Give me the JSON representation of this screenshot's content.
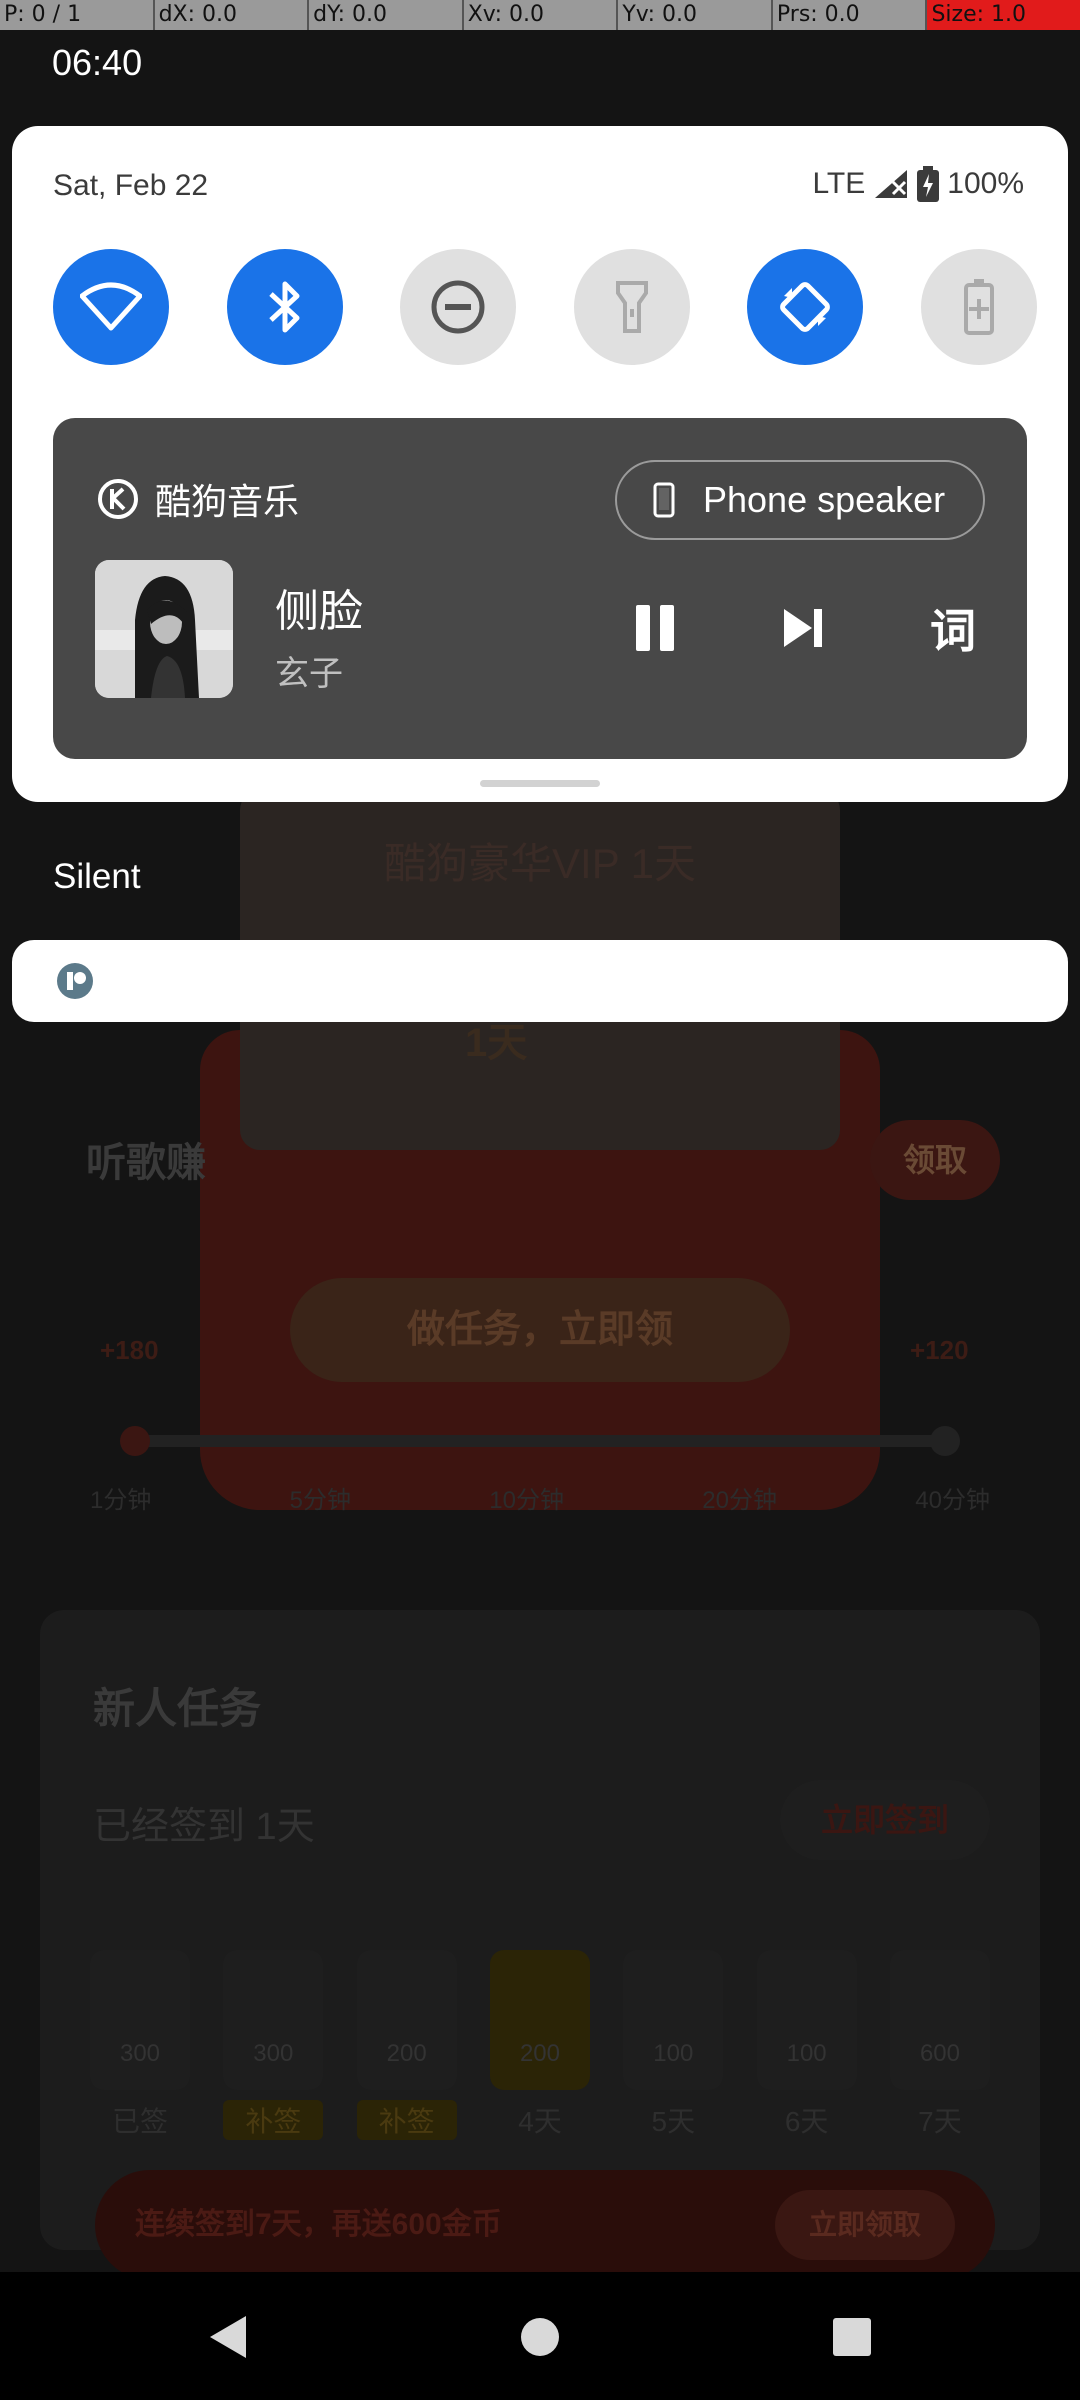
{
  "debug": {
    "p": "P: 0 / 1",
    "dx": "dX: 0.0",
    "dy": "dY: 0.0",
    "xv": "Xv: 0.0",
    "yv": "Yv: 0.0",
    "prs": "Prs: 0.0",
    "size": "Size: 1.0"
  },
  "status_bar": {
    "time": "06:40"
  },
  "quick_settings": {
    "date": "Sat, Feb 22",
    "network": "LTE",
    "battery": "100%",
    "tiles": [
      {
        "name": "wifi",
        "state": "on",
        "icon": "wifi-icon"
      },
      {
        "name": "bluetooth",
        "state": "on",
        "icon": "bluetooth-icon"
      },
      {
        "name": "do-not-disturb",
        "state": "off",
        "icon": "dnd-icon"
      },
      {
        "name": "flashlight",
        "state": "off",
        "icon": "flashlight-icon"
      },
      {
        "name": "auto-rotate",
        "state": "on",
        "icon": "rotate-icon"
      },
      {
        "name": "battery-saver",
        "state": "off",
        "icon": "battery-saver-icon"
      }
    ],
    "accent_color": "#1a73e8"
  },
  "media": {
    "app_name": "酷狗音乐",
    "output": "Phone speaker",
    "song_title": "侧脸",
    "artist": "玄子",
    "lyrics_label": "词"
  },
  "notifications": {
    "section_label": "Silent"
  },
  "background_app": {
    "vip_title": "酷狗豪华VIP 1天",
    "day_badge": "1天",
    "listen_label": "听歌赚",
    "claim_label": "领取",
    "task_button": "做任务，立即领",
    "reward_left": "+180",
    "reward_right": "+120",
    "minutes": [
      "1分钟",
      "5分钟",
      "10分钟",
      "20分钟",
      "40分钟"
    ],
    "new_user_title": "新人任务",
    "signed_text": "已经签到 1天",
    "sign_button": "立即签到",
    "days": [
      {
        "coins": "300",
        "label": "已签"
      },
      {
        "coins": "300",
        "label": "补签"
      },
      {
        "coins": "200",
        "label": "补签"
      },
      {
        "coins": "200",
        "label": "4天"
      },
      {
        "coins": "100",
        "label": "5天"
      },
      {
        "coins": "100",
        "label": "6天"
      },
      {
        "coins": "600",
        "label": "7天"
      }
    ],
    "banner_text": "连续签到7天，再送600金币",
    "banner_button": "立即领取"
  }
}
